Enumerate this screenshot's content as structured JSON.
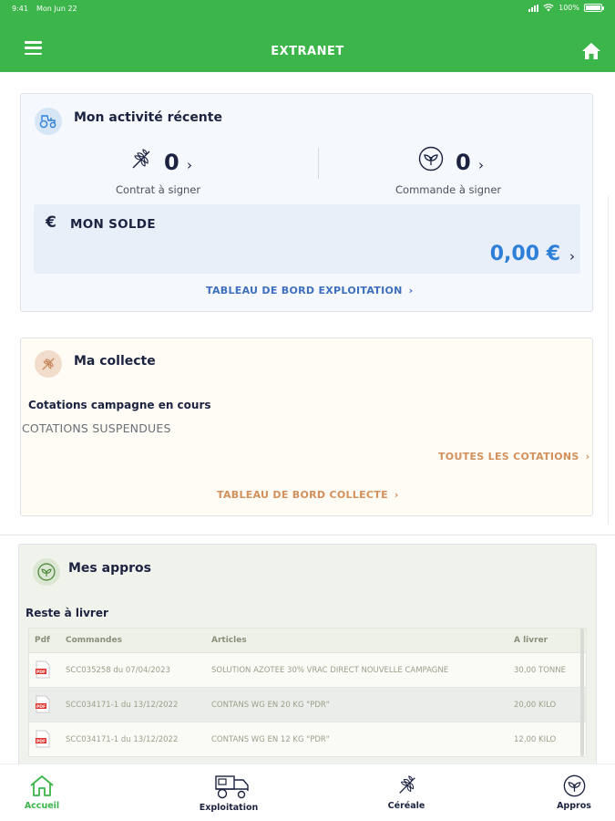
{
  "status_bar": {
    "time": "9:41",
    "date": "Mon Jun 22",
    "battery": "100%",
    "battery_level": 1.0
  },
  "header": {
    "title": "EXTRANET",
    "menu_icon": "hamburger-icon",
    "home_icon": "home-icon"
  },
  "activity": {
    "title": "Mon activité récente",
    "icon": "tractor-icon",
    "contract": {
      "value": "0",
      "label": "Contrat à signer",
      "icon": "wheat-icon"
    },
    "order": {
      "value": "0",
      "label": "Commande à signer",
      "icon": "plant-icon"
    },
    "balance": {
      "currency_symbol": "€",
      "label": "MON SOLDE",
      "amount": "0,00 €"
    },
    "dashboard_link": "TABLEAU DE BORD EXPLOITATION"
  },
  "collecte": {
    "title": "Ma collecte",
    "icon": "wheat-icon",
    "subtitle": "Cotations campagne en cours",
    "status": "COTATIONS SUSPENDUES",
    "all_link": "TOUTES LES COTATIONS",
    "dashboard_link": "TABLEAU DE BORD COLLECTE"
  },
  "appros": {
    "title": "Mes appros",
    "icon": "plant-icon",
    "subtitle": "Reste à livrer",
    "columns": [
      "Pdf",
      "Commandes",
      "Articles",
      "A livrer"
    ],
    "rows": [
      {
        "order": "SCC035258 du 07/04/2023",
        "article": "SOLUTION AZOTEE 30% VRAC DIRECT NOUVELLE CAMPAGNE",
        "qty": "30,00 TONNE"
      },
      {
        "order": "SCC034171-1 du 13/12/2022",
        "article": "CONTANS WG EN 20 KG \"PDR\"",
        "qty": "20,00 KILO"
      },
      {
        "order": "SCC034171-1 du 13/12/2022",
        "article": "CONTANS WG EN 12 KG \"PDR\"",
        "qty": "12,00 KILO"
      }
    ]
  },
  "bottom_nav": [
    {
      "label": "Accueil",
      "icon": "home-outline-icon",
      "active": true
    },
    {
      "label": "Exploitation",
      "icon": "harvester-icon",
      "active": false
    },
    {
      "label": "Céréale",
      "icon": "wheat-icon",
      "active": false
    },
    {
      "label": "Appros",
      "icon": "plant-icon",
      "active": false
    }
  ],
  "colors": {
    "brand_green": "#3cb54a",
    "accent_blue": "#2e7fd8",
    "accent_orange": "#d2905c",
    "text_dark": "#1c2340"
  }
}
